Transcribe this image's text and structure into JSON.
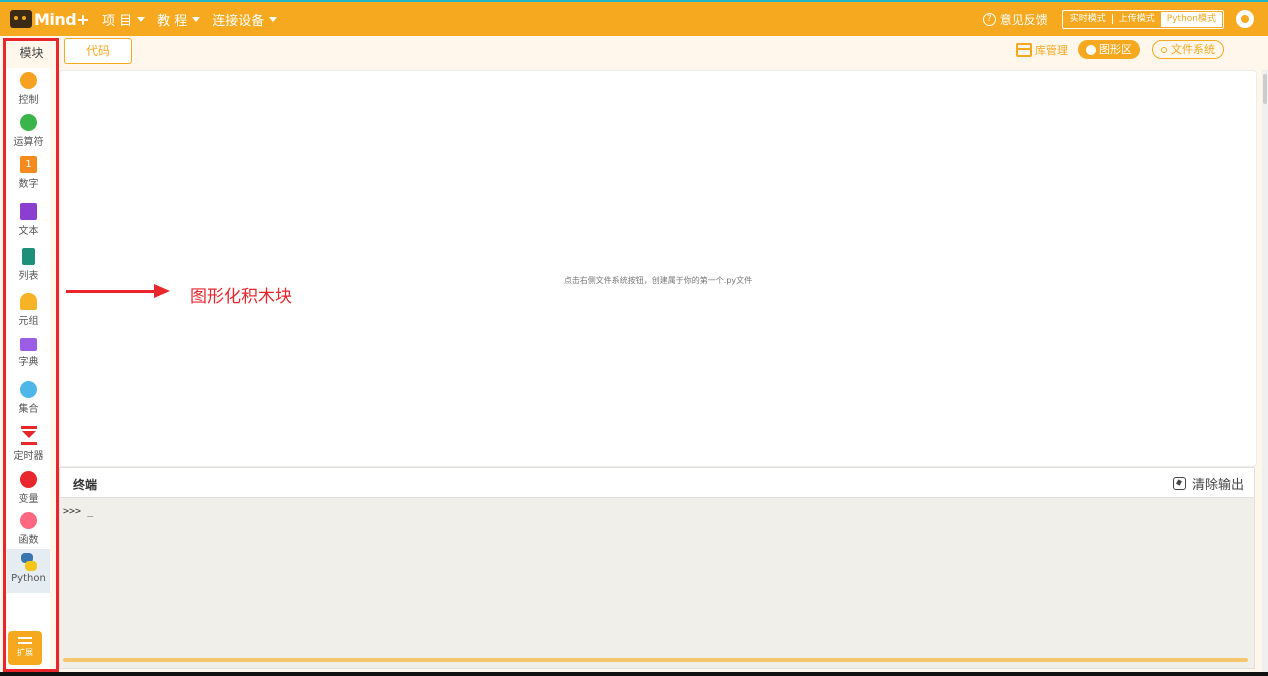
{
  "topbar": {
    "logo_text": "Mind+",
    "menu": [
      {
        "label": "项 目"
      },
      {
        "label": "教 程"
      },
      {
        "label": "连接设备"
      }
    ],
    "feedback_label": "意见反馈",
    "modes": [
      {
        "label": "实时模式"
      },
      {
        "label": "上传模式"
      },
      {
        "label": "Python模式"
      }
    ],
    "accent_color": "#f6a91f"
  },
  "tabs": {
    "modules_label": "模块",
    "code_label": "代码",
    "lib_manager_label": "库管理",
    "graphic_label": "图形区",
    "file_system_label": "文件系统"
  },
  "sidebar": {
    "categories": [
      {
        "label": "控制",
        "icon": "control-icon",
        "color": "#f6a11f"
      },
      {
        "label": "运算符",
        "icon": "operators-icon",
        "color": "#3bb54a"
      },
      {
        "label": "数字",
        "icon": "number-icon",
        "color": "#f58b1f"
      },
      {
        "label": "文本",
        "icon": "text-icon",
        "color": "#8a3fd1"
      },
      {
        "label": "列表",
        "icon": "list-icon",
        "color": "#1f8f7a"
      },
      {
        "label": "元组",
        "icon": "tuple-icon",
        "color": "#f5b325"
      },
      {
        "label": "字典",
        "icon": "dict-icon",
        "color": "#9b5de5"
      },
      {
        "label": "集合",
        "icon": "set-icon",
        "color": "#4fb6e8"
      },
      {
        "label": "定时器",
        "icon": "timer-icon",
        "color": "#e8262c"
      },
      {
        "label": "变量",
        "icon": "variable-icon",
        "color": "#e8262c"
      },
      {
        "label": "函数",
        "icon": "function-icon",
        "color": "#ff6680"
      },
      {
        "label": "Python",
        "icon": "python-icon",
        "color": "#3a76b0"
      }
    ],
    "extension_label": "扩展",
    "number_icon_glyph": "1"
  },
  "workspace": {
    "hint": "点击右侧文件系统按钮，创建属于你的第一个.py文件"
  },
  "annotation": {
    "text": "图形化积木块",
    "color": "#e8262c"
  },
  "terminal": {
    "title": "终端",
    "clear_label": "清除输出",
    "prompt": ">>> _"
  }
}
